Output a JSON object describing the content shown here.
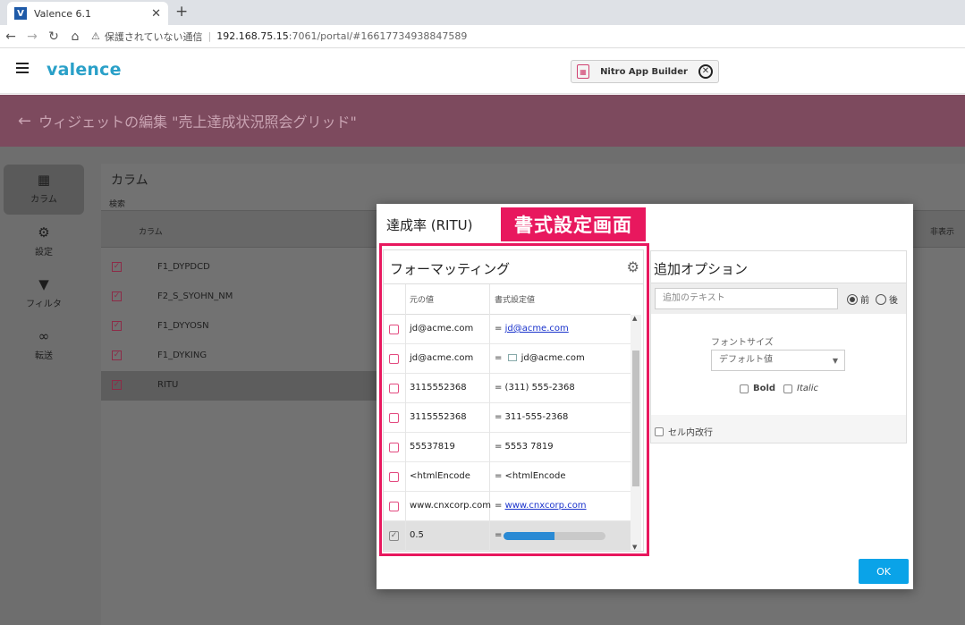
{
  "browser": {
    "tab_title": "Valence 6.1",
    "tab_favicon": "V",
    "tab_close": "✕",
    "new_tab": "+",
    "security_text": "保護されていない通信",
    "url_host": "192.168.75.15",
    "url_path": ":7061/portal/#16617734938847589"
  },
  "app": {
    "logo": "valence",
    "nitro_label": "Nitro App Builder",
    "nitro_close": "✕"
  },
  "page": {
    "title": "ウィジェットの編集 \"売上達成状況照会グリッド\"",
    "nav": [
      {
        "label": "カラム",
        "icon": "grid-icon"
      },
      {
        "label": "設定",
        "icon": "gear-icon"
      },
      {
        "label": "フィルタ",
        "icon": "filter-icon"
      },
      {
        "label": "転送",
        "icon": "link-icon"
      }
    ],
    "panel_title": "カラム",
    "search_label": "検索",
    "col_header": "カラム",
    "hidden_header": "非表示",
    "columns": [
      "F1_DYPDCD",
      "F2_S_SYOHN_NM",
      "F1_DYYOSN",
      "F1_DYKING",
      "RITU"
    ]
  },
  "modal": {
    "title": "達成率 (RITU)",
    "callout": "書式設定画面",
    "formatting": {
      "title": "フォーマッティング",
      "col_original": "元の値",
      "col_formatted": "書式設定値",
      "rows": [
        {
          "original": "jd@acme.com",
          "prefix": "= ",
          "link": "jd@acme.com"
        },
        {
          "original": "jd@acme.com",
          "prefix": "= ",
          "mail_text": "jd@acme.com"
        },
        {
          "original": "3115552368",
          "result": "= (311) 555-2368"
        },
        {
          "original": "3115552368",
          "result": "= 311-555-2368"
        },
        {
          "original": "55537819",
          "result": "= 5553 7819"
        },
        {
          "original": "<htmlEncode",
          "result": "= <htmlEncode"
        },
        {
          "original": "www.cnxcorp.com",
          "prefix": "= ",
          "link": "www.cnxcorp.com"
        },
        {
          "original": "0.5",
          "prefix": "=",
          "progress": 0.5,
          "selected": true
        }
      ]
    },
    "options": {
      "title": "追加オプション",
      "text_placeholder": "追加のテキスト",
      "radio_before": "前",
      "radio_after": "後",
      "font_size_label": "フォントサイズ",
      "font_size_value": "デフォルト値",
      "bold_label": "Bold",
      "italic_label": "Italic",
      "wrap_label": "セル内改行"
    },
    "ok_label": "OK"
  },
  "colors": {
    "accent": "#e8185e",
    "header_bar": "#7d4a5e",
    "ok_button": "#0aa3e8",
    "logo": "#2aa0c8",
    "progress_fill": "#2a8ad4"
  }
}
